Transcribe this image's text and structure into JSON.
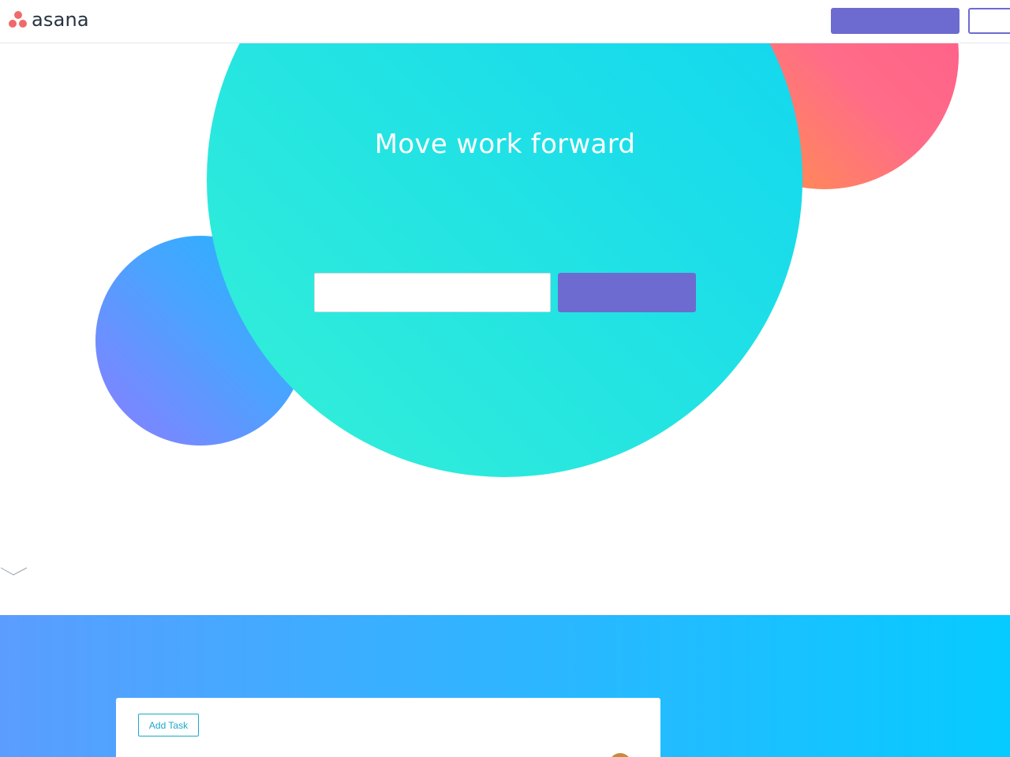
{
  "header": {
    "logo_text": "asana",
    "logo_color": "#f06a6a",
    "primary_button_label": "",
    "secondary_button_label": ""
  },
  "hero": {
    "title": "Move work forward",
    "email_value": "",
    "email_placeholder": "",
    "submit_label": ""
  },
  "band": {
    "card": {
      "add_task_label": "Add Task"
    }
  },
  "colors": {
    "brand_purple": "#6d6bd0",
    "teal": "#1fe0e6",
    "coral": "#ff6c88",
    "blue": "#4aa3ff",
    "accent_link": "#1aa9c8"
  },
  "icons": {
    "scroll_indicator": "chevron-down-icon",
    "logo_mark": "asana-dots-icon"
  }
}
